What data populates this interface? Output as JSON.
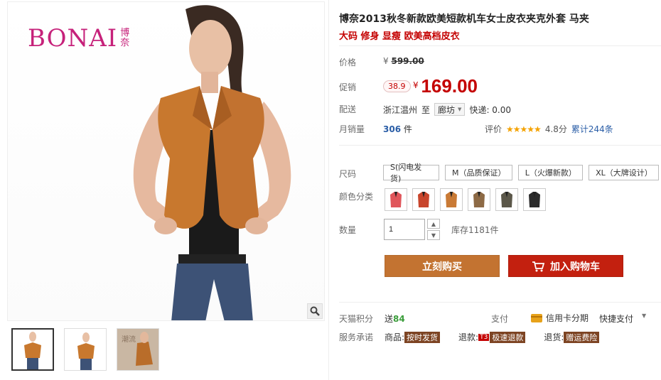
{
  "gallery": {
    "logo": {
      "brand": "BONAI",
      "brand_cn": "博奈"
    },
    "thumbs": [
      "thumb-1",
      "thumb-2",
      "thumb-3"
    ],
    "thumb3_watermark": "潮流"
  },
  "product": {
    "title": "博奈2013秋冬新款欧美短款机车女士皮衣夹克外套 马夹",
    "subtitle": "大码 修身 显瘦 欧美高档皮衣"
  },
  "price": {
    "label": "价格",
    "currency": "¥",
    "original": "599.00",
    "promo_label": "促销",
    "discount_badge": "38.9",
    "current": "169.00"
  },
  "delivery": {
    "label": "配送",
    "from": "浙江温州",
    "to_word": "至",
    "region": "廊坊",
    "express": "快递: 0.00"
  },
  "sales": {
    "label": "月销量",
    "count": "306",
    "unit": "件",
    "rating_label": "评价",
    "stars": "★★★★★",
    "score": "4.8分",
    "cumulative": "累计244条"
  },
  "sizes": {
    "label": "尺码",
    "options": [
      "S(闪电发货)",
      "M（品质保证）",
      "L（火爆新款）",
      "XL（大牌设计）"
    ]
  },
  "colors": {
    "label": "颜色分类",
    "swatches": [
      "#e0565b",
      "#c8452c",
      "#c97a35",
      "#8d6a45",
      "#5b5749",
      "#2b2b2b"
    ]
  },
  "quantity": {
    "label": "数量",
    "value": "1",
    "stock": "库存1181件",
    "up": "▲",
    "down": "▼"
  },
  "actions": {
    "buy_now": "立刻购买",
    "add_cart": "加入购物车"
  },
  "tmall": {
    "points_label": "天猫积分",
    "points_prefix": "送",
    "points_value": "84",
    "pay_label": "支付",
    "credit": "信用卡分期",
    "quick_pay": "快捷支付",
    "more": "▼"
  },
  "promise": {
    "label": "服务承诺",
    "goods_label": "商品:",
    "goods_tag": "按时发货",
    "refund_label": "退款:",
    "refund_t3": "T3",
    "refund_tag": "极速退款",
    "return_label": "退货:",
    "return_tag": "赠运费险"
  },
  "colors_theme": {
    "price_red": "#c40000",
    "buy_orange": "#c37331",
    "cart_red": "#c3200f",
    "link_blue": "#2b5ea7",
    "star_gold": "#f4a200"
  }
}
